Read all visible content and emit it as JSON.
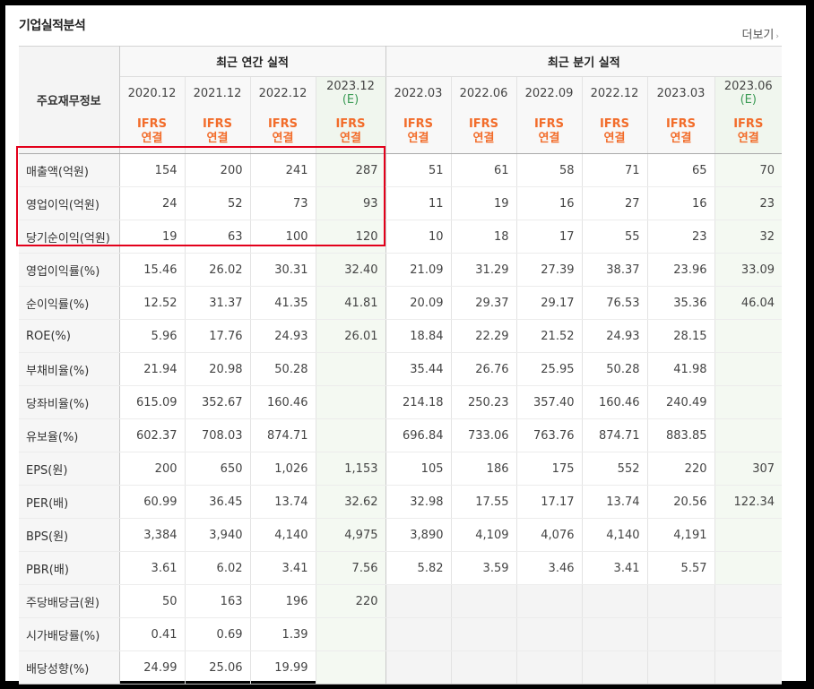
{
  "section_title": "기업실적분석",
  "more_label": "더보기",
  "more_arrow": "›",
  "header": {
    "corner_label": "주요재무정보",
    "annual_group": "최근 연간 실적",
    "quarter_group": "최근 분기 실적",
    "annual_periods": [
      "2020.12",
      "2021.12",
      "2022.12",
      "2023.12"
    ],
    "quarter_periods": [
      "2022.03",
      "2022.06",
      "2022.09",
      "2022.12",
      "2023.03",
      "2023.06"
    ],
    "estimate_mark": "(E)",
    "ifrs_top": "IFRS",
    "ifrs_bottom": "연결"
  },
  "rows": [
    {
      "label": "매출액(억원)",
      "annual": [
        "154",
        "200",
        "241",
        "287"
      ],
      "quarter": [
        "51",
        "61",
        "58",
        "71",
        "65",
        "70"
      ]
    },
    {
      "label": "영업이익(억원)",
      "annual": [
        "24",
        "52",
        "73",
        "93"
      ],
      "quarter": [
        "11",
        "19",
        "16",
        "27",
        "16",
        "23"
      ]
    },
    {
      "label": "당기순이익(억원)",
      "annual": [
        "19",
        "63",
        "100",
        "120"
      ],
      "quarter": [
        "10",
        "18",
        "17",
        "55",
        "23",
        "32"
      ]
    },
    {
      "label": "영업이익률(%)",
      "annual": [
        "15.46",
        "26.02",
        "30.31",
        "32.40"
      ],
      "quarter": [
        "21.09",
        "31.29",
        "27.39",
        "38.37",
        "23.96",
        "33.09"
      ]
    },
    {
      "label": "순이익률(%)",
      "annual": [
        "12.52",
        "31.37",
        "41.35",
        "41.81"
      ],
      "quarter": [
        "20.09",
        "29.37",
        "29.17",
        "76.53",
        "35.36",
        "46.04"
      ]
    },
    {
      "label": "ROE(%)",
      "annual": [
        "5.96",
        "17.76",
        "24.93",
        "26.01"
      ],
      "quarter": [
        "18.84",
        "22.29",
        "21.52",
        "24.93",
        "28.15",
        ""
      ]
    },
    {
      "label": "부채비율(%)",
      "annual": [
        "21.94",
        "20.98",
        "50.28",
        ""
      ],
      "quarter": [
        "35.44",
        "26.76",
        "25.95",
        "50.28",
        "41.98",
        ""
      ]
    },
    {
      "label": "당좌비율(%)",
      "annual": [
        "615.09",
        "352.67",
        "160.46",
        ""
      ],
      "quarter": [
        "214.18",
        "250.23",
        "357.40",
        "160.46",
        "240.49",
        ""
      ]
    },
    {
      "label": "유보율(%)",
      "annual": [
        "602.37",
        "708.03",
        "874.71",
        ""
      ],
      "quarter": [
        "696.84",
        "733.06",
        "763.76",
        "874.71",
        "883.85",
        ""
      ]
    },
    {
      "label": "EPS(원)",
      "annual": [
        "200",
        "650",
        "1,026",
        "1,153"
      ],
      "quarter": [
        "105",
        "186",
        "175",
        "552",
        "220",
        "307"
      ]
    },
    {
      "label": "PER(배)",
      "annual": [
        "60.99",
        "36.45",
        "13.74",
        "32.62"
      ],
      "quarter": [
        "32.98",
        "17.55",
        "17.17",
        "13.74",
        "20.56",
        "122.34"
      ]
    },
    {
      "label": "BPS(원)",
      "annual": [
        "3,384",
        "3,940",
        "4,140",
        "4,975"
      ],
      "quarter": [
        "3,890",
        "4,109",
        "4,076",
        "4,140",
        "4,191",
        ""
      ]
    },
    {
      "label": "PBR(배)",
      "annual": [
        "3.61",
        "6.02",
        "3.41",
        "7.56"
      ],
      "quarter": [
        "5.82",
        "3.59",
        "3.46",
        "3.41",
        "5.57",
        ""
      ]
    },
    {
      "label": "주당배당금(원)",
      "annual": [
        "50",
        "163",
        "196",
        "220"
      ],
      "quarter": [
        "",
        "",
        "",
        "",
        "",
        ""
      ]
    },
    {
      "label": "시가배당률(%)",
      "annual": [
        "0.41",
        "0.69",
        "1.39",
        ""
      ],
      "quarter": [
        "",
        "",
        "",
        "",
        "",
        ""
      ]
    },
    {
      "label": "배당성향(%)",
      "annual": [
        "24.99",
        "25.06",
        "19.99",
        ""
      ],
      "quarter": [
        "",
        "",
        "",
        "",
        "",
        ""
      ]
    }
  ],
  "colors": {
    "ifrs": "#f26c2a",
    "estimate_bg": "#f4f9f2",
    "estimate_mark": "#3b9b55",
    "highlight_box": "#e3001b"
  }
}
